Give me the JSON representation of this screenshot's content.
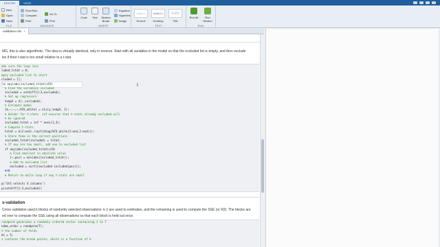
{
  "tabs": [
    "EDITOR",
    "VIEW"
  ],
  "ribbon": {
    "file": {
      "buttons": [
        {
          "label": "New",
          "icon": "new-file-icon"
        },
        {
          "label": "Open",
          "icon": "open-folder-icon"
        },
        {
          "label": "Save",
          "icon": "save-icon"
        }
      ],
      "label": "FILE"
    },
    "navigate": {
      "find_files": "Find Files",
      "compare": "Compare",
      "print": "Print",
      "go_to": "Go To",
      "find": "Find",
      "label": "NAVIGATE"
    },
    "insert": {
      "code": "Code",
      "text": "Text",
      "section_break": "Section Break",
      "equation": "Equation",
      "hyperlink": "Hyperlink",
      "image": "Image",
      "label": "INSERT"
    },
    "text": {
      "styles": [
        {
          "preview": "AaBbCc",
          "name": "Normal"
        },
        {
          "preview": "AaBbCc",
          "name": "Heading"
        },
        {
          "preview": "AaBb",
          "name": "Title"
        }
      ],
      "label": "TEXT"
    },
    "run": {
      "run_all": "Run All",
      "run_section": "Run Section",
      "label": "RUN"
    }
  },
  "file_tab": {
    "name": "validation.mlx",
    "close": "×"
  },
  "prose1": [
    "MG, this is also algorithmic. The idea is virtually identical, only in reverse. Start with all variables in the model so that the excluded list is empty, and then exclude",
    "les if their t-stat is too small relative to a t-stat"
  ],
  "code1": [
    {
      "t": "ake sure the loop runs",
      "cls": "c"
    },
    {
      "t": "luded_tstat = 0;",
      "cls": ""
    },
    {
      "t": "mpty excluded list to start",
      "cls": "c"
    },
    {
      "t": "cluded = [];",
      "cls": ""
    },
    {
      "t": "le any(abs(included_tstat)<CV)",
      "cls": "hl"
    },
    {
      "t": "  % Find the variables included",
      "cls": "c"
    },
    {
      "t": "  included = setdiff(1:3,excluded);",
      "cls": ""
    },
    {
      "t": "  % Set up regressors",
      "cls": "c"
    },
    {
      "t": "  tempX = X(:,included);",
      "cls": ""
    },
    {
      "t": "  % Estimate model",
      "cls": "c"
    },
    {
      "t": "  [b,~,~,~,VCV_white] = ols(y,tempX, 1);",
      "cls": ""
    },
    {
      "t": "  % Holder for t-stats  inf ensures that t-stats already excluded will",
      "cls": "c"
    },
    {
      "t": "  % be ignored",
      "cls": "c"
    },
    {
      "t": "  included_tstat = inf * ones(1,3);",
      "cls": ""
    },
    {
      "t": "  % Compute t-stats",
      "cls": "c"
    },
    {
      "t": "  tstat = b(2:end)./sqrt(diag(VCV_white(2:end,2:end)));",
      "cls": ""
    },
    {
      "t": "  % Store them in the correct positions",
      "cls": "c"
    },
    {
      "t": "  included_tstat(included) = tstat;",
      "cls": ""
    },
    {
      "t": "  % If any are too small, add one to excluded list",
      "cls": "c"
    },
    {
      "t": "  if any(abs(included_tstat)<CV)",
      "cls": ""
    },
    {
      "t": "     % Find smallest in absolute value",
      "cls": "c"
    },
    {
      "t": "     [~,pos] = min(abs(included_tstat));",
      "cls": ""
    },
    {
      "t": "     % Add to excluded list",
      "cls": "c"
    },
    {
      "t": "     excluded = sort([excluded included(pos)]);",
      "cls": ""
    },
    {
      "t": "  end",
      "cls": "k"
    },
    {
      "t": "  % Return to while loop if any t-stats are small",
      "cls": "c"
    },
    {
      "t": "",
      "cls": ""
    },
    {
      "t": "p('GtS selects X columns')",
      "cls": ""
    },
    {
      "t": "p(setdiff(1:3,excluded))",
      "cls": ""
    }
  ],
  "heading": "s-validation",
  "prose2": [
    "Cross validation used k blocks of randomly selected observations. k-1 are used to estimates, and the remaining is used to compute the SSE (or R2). The blocks are",
    "ed over to compute the SSE using all observations so that each block is held out once."
  ],
  "code2": [
    {
      "t": "randperm generates a randomly ordered vector containing 1 to T",
      "cls": "c"
    },
    {
      "t": "ndom_order = randperm(T);",
      "cls": ""
    },
    {
      "t": "t the number of folds",
      "cls": "c"
    },
    {
      "t": "ds = 5;",
      "cls": ""
    },
    {
      "t": "s contains the break points, which is a function of k",
      "cls": "c"
    }
  ]
}
